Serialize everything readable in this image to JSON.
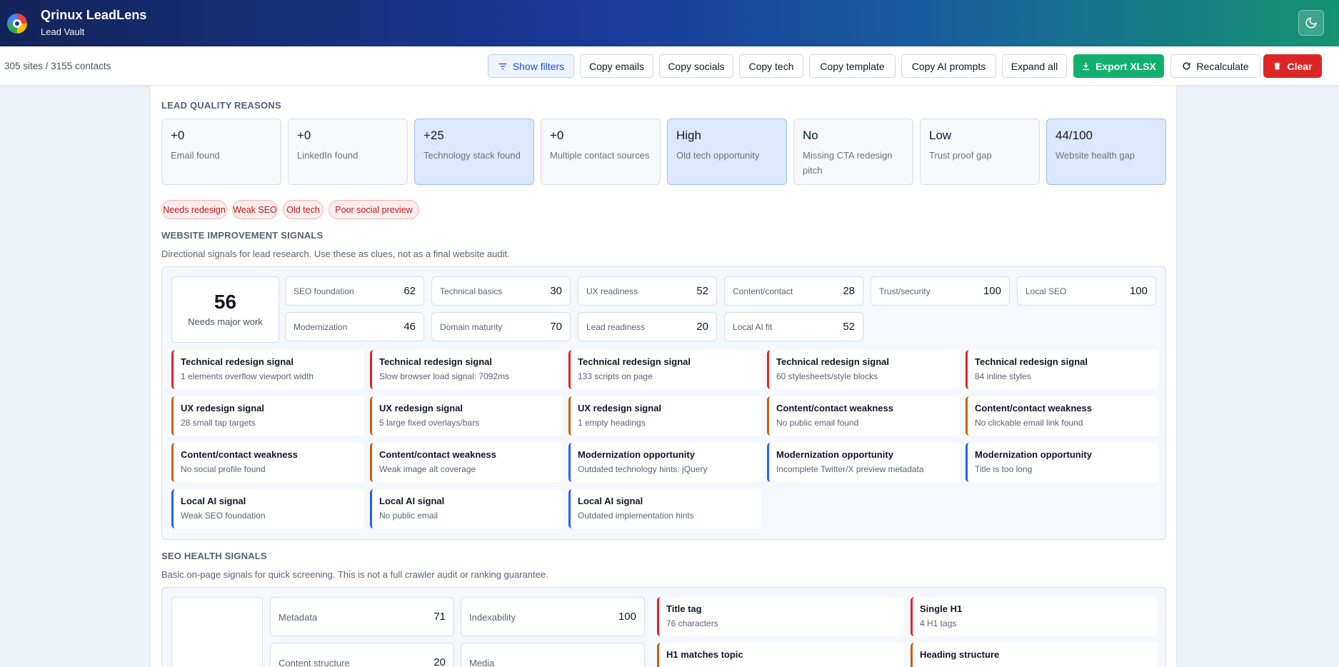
{
  "header": {
    "title": "Qrinux LeadLens",
    "subtitle": "Lead Vault"
  },
  "toolbar": {
    "counts": "305 sites / 3155 contacts",
    "show_filters": "Show filters",
    "copy_emails": "Copy emails",
    "copy_socials": "Copy socials",
    "copy_tech": "Copy tech",
    "copy_template": "Copy template",
    "copy_ai_prompts": "Copy AI prompts",
    "expand_all": "Expand all",
    "export_xlsx": "Export XLSX",
    "recalculate": "Recalculate",
    "clear": "Clear"
  },
  "lead_quality": {
    "title": "LEAD QUALITY REASONS",
    "reasons": [
      {
        "value": "+0",
        "label": "Email found",
        "highlight": false
      },
      {
        "value": "+0",
        "label": "LinkedIn found",
        "highlight": false
      },
      {
        "value": "+25",
        "label": "Technology stack found",
        "highlight": true
      },
      {
        "value": "+0",
        "label": "Multiple contact sources",
        "highlight": false
      },
      {
        "value": "High",
        "label": "Old tech opportunity",
        "highlight": true
      },
      {
        "value": "No",
        "label": "Missing CTA redesign pitch",
        "highlight": false
      },
      {
        "value": "Low",
        "label": "Trust proof gap",
        "highlight": false
      },
      {
        "value": "44/100",
        "label": "Website health gap",
        "highlight": true
      }
    ],
    "tags": [
      "Needs redesign",
      "Weak SEO",
      "Old tech",
      "Poor social preview"
    ]
  },
  "improvement": {
    "title": "WEBSITE IMPROVEMENT SIGNALS",
    "description": "Directional signals for lead research. Use these as clues, not as a final website audit.",
    "score": "56",
    "score_label": "Needs major work",
    "metrics": [
      {
        "name": "SEO foundation",
        "value": "62"
      },
      {
        "name": "Technical basics",
        "value": "30"
      },
      {
        "name": "UX readiness",
        "value": "52"
      },
      {
        "name": "Content/contact",
        "value": "28"
      },
      {
        "name": "Trust/security",
        "value": "100"
      },
      {
        "name": "Local SEO",
        "value": "100"
      },
      {
        "name": "Modernization",
        "value": "46"
      },
      {
        "name": "Domain maturity",
        "value": "70"
      },
      {
        "name": "Lead readiness",
        "value": "20"
      },
      {
        "name": "Local AI fit",
        "value": "52"
      }
    ],
    "signals": [
      {
        "title": "Technical redesign signal",
        "detail": "1 elements overflow viewport width",
        "color": "#dc2626"
      },
      {
        "title": "Technical redesign signal",
        "detail": "Slow browser load signal: 7092ms",
        "color": "#dc2626"
      },
      {
        "title": "Technical redesign signal",
        "detail": "133 scripts on page",
        "color": "#dc2626"
      },
      {
        "title": "Technical redesign signal",
        "detail": "60 stylesheets/style blocks",
        "color": "#dc2626"
      },
      {
        "title": "Technical redesign signal",
        "detail": "84 inline styles",
        "color": "#dc2626"
      },
      {
        "title": "UX redesign signal",
        "detail": "28 small tap targets",
        "color": "#c2620f"
      },
      {
        "title": "UX redesign signal",
        "detail": "5 large fixed overlays/bars",
        "color": "#c2620f"
      },
      {
        "title": "UX redesign signal",
        "detail": "1 empty headings",
        "color": "#c2620f"
      },
      {
        "title": "Content/contact weakness",
        "detail": "No public email found",
        "color": "#c2620f"
      },
      {
        "title": "Content/contact weakness",
        "detail": "No clickable email link found",
        "color": "#c2620f"
      },
      {
        "title": "Content/contact weakness",
        "detail": "No social profile found",
        "color": "#c2620f"
      },
      {
        "title": "Content/contact weakness",
        "detail": "Weak image alt coverage",
        "color": "#c2620f"
      },
      {
        "title": "Modernization opportunity",
        "detail": "Outdated technology hints: jQuery",
        "color": "#2563eb"
      },
      {
        "title": "Modernization opportunity",
        "detail": "Incomplete Twitter/X preview metadata",
        "color": "#2563eb"
      },
      {
        "title": "Modernization opportunity",
        "detail": "Title is too long",
        "color": "#2563eb"
      },
      {
        "title": "Local AI signal",
        "detail": "Weak SEO foundation",
        "color": "#2563eb"
      },
      {
        "title": "Local AI signal",
        "detail": "No public email",
        "color": "#2563eb"
      },
      {
        "title": "Local AI signal",
        "detail": "Outdated implementation hints",
        "color": "#2563eb"
      }
    ]
  },
  "seo": {
    "title": "SEO HEALTH SIGNALS",
    "description": "Basic on-page signals for quick screening. This is not a full crawler audit or ranking guarantee.",
    "metrics": [
      {
        "name": "Metadata",
        "value": "71"
      },
      {
        "name": "Indexability",
        "value": "100"
      },
      {
        "name": "Content structure",
        "value": "20"
      },
      {
        "name": "Media",
        "value": ""
      }
    ],
    "signals": [
      {
        "title": "Title tag",
        "detail": "76 characters"
      },
      {
        "title": "Single H1",
        "detail": "4 H1 tags"
      },
      {
        "title": "H1 matches topic",
        "detail": ""
      },
      {
        "title": "Heading structure",
        "detail": ""
      }
    ]
  }
}
